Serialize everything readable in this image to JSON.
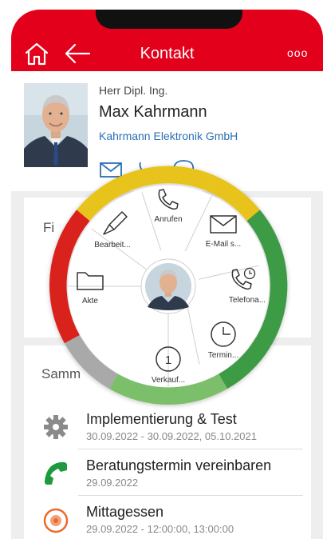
{
  "header": {
    "title": "Kontakt",
    "more": "ooo",
    "color": "#e3001b"
  },
  "contact": {
    "salutation": "Herr Dipl. Ing.",
    "name": "Max Kahrmann",
    "company": "Kahrmann Elektronik GmbH",
    "actions": [
      "mail-icon",
      "phone-icon",
      "chat-icon"
    ]
  },
  "panel1": {
    "label": "Fi"
  },
  "panel2": {
    "label": "Samm"
  },
  "activities": [
    {
      "title": "Implementierung & Test",
      "subtitle": "30.09.2022 - 30.09.2022, 05.10.2021",
      "icon": "gear-icon"
    },
    {
      "title": "Beratungstermin vereinbaren",
      "subtitle": "29.09.2022",
      "icon": "phone-icon"
    },
    {
      "title": "Mittagessen",
      "subtitle": "29.09.2022 - 12:00:00, 13:00:00",
      "icon": "target-icon"
    }
  ],
  "wheel": {
    "items": [
      {
        "label": "Anrufen",
        "icon": "phone-icon"
      },
      {
        "label": "E-Mail s...",
        "icon": "mail-icon"
      },
      {
        "label": "Telefona...",
        "icon": "phone-clock-icon"
      },
      {
        "label": "Termin...",
        "icon": "clock-icon"
      },
      {
        "label": "Verkauf...",
        "icon": "number-one-icon",
        "badge": "1"
      },
      {
        "label": "Akte",
        "icon": "folder-icon"
      },
      {
        "label": "Bearbeit...",
        "icon": "pencil-icon"
      }
    ],
    "ring_colors": [
      "#e8c31e",
      "#3e9a45",
      "#7cbf6a",
      "#a9a9a9",
      "#d9231c"
    ]
  }
}
